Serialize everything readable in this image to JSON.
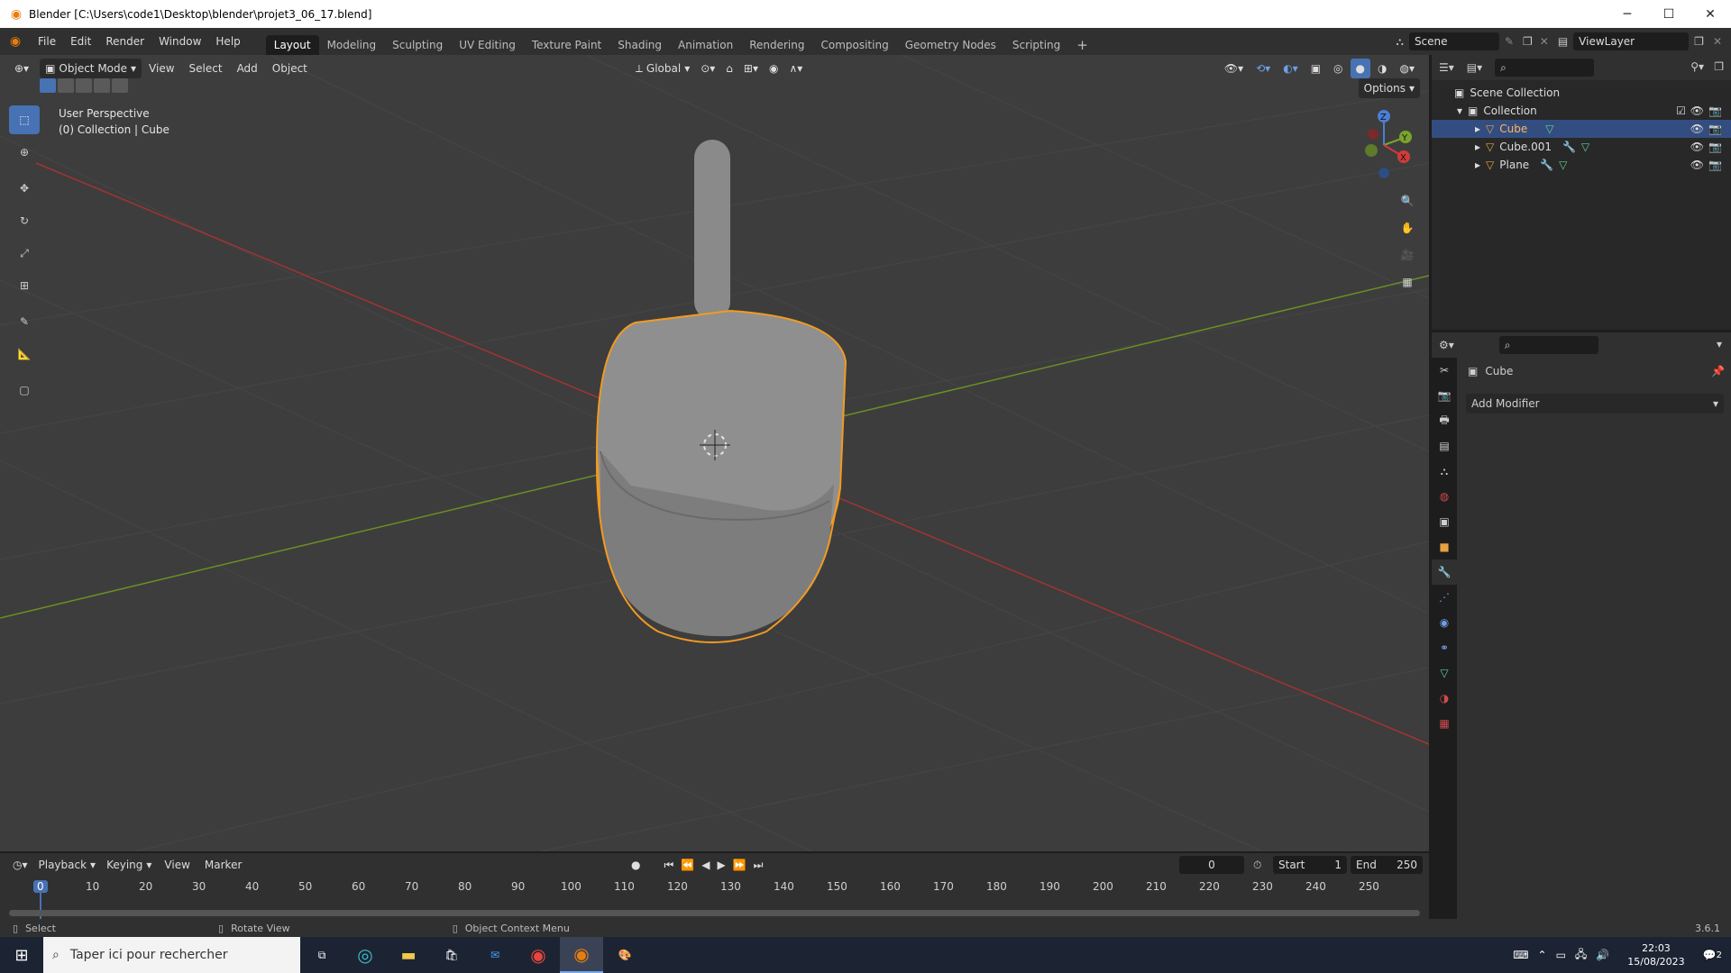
{
  "window": {
    "title": "Blender [C:\\Users\\code1\\Desktop\\blender\\projet3_06_17.blend]"
  },
  "menu": [
    "File",
    "Edit",
    "Render",
    "Window",
    "Help"
  ],
  "workspaces": [
    "Layout",
    "Modeling",
    "Sculpting",
    "UV Editing",
    "Texture Paint",
    "Shading",
    "Animation",
    "Rendering",
    "Compositing",
    "Geometry Nodes",
    "Scripting"
  ],
  "top_right": {
    "scene": "Scene",
    "view_layer": "ViewLayer"
  },
  "viewport": {
    "mode": "Object Mode",
    "menus": [
      "View",
      "Select",
      "Add",
      "Object"
    ],
    "transform_orientation": "Global",
    "options_label": "Options",
    "overlay_line1": "User Perspective",
    "overlay_line2": "(0) Collection | Cube",
    "gizmo": {
      "z": "Z",
      "y": "Y",
      "x": "X"
    }
  },
  "outliner": {
    "root": "Scene Collection",
    "collection": "Collection",
    "items": [
      {
        "name": "Cube",
        "selected": true
      },
      {
        "name": "Cube.001",
        "selected": false
      },
      {
        "name": "Plane",
        "selected": false
      }
    ]
  },
  "properties": {
    "object_name": "Cube",
    "add_modifier": "Add Modifier"
  },
  "timeline": {
    "menus": [
      "Playback",
      "Keying",
      "View",
      "Marker"
    ],
    "current_frame": "0",
    "start_label": "Start",
    "start_value": "1",
    "end_label": "End",
    "end_value": "250",
    "ticks": [
      "0",
      "10",
      "20",
      "30",
      "40",
      "50",
      "60",
      "70",
      "80",
      "90",
      "100",
      "110",
      "120",
      "130",
      "140",
      "150",
      "160",
      "170",
      "180",
      "190",
      "200",
      "210",
      "220",
      "230",
      "240",
      "250"
    ]
  },
  "statusbar": {
    "select": "Select",
    "rotate": "Rotate View",
    "context": "Object Context Menu",
    "version": "3.6.1"
  },
  "taskbar": {
    "search_placeholder": "Taper ici pour rechercher",
    "time": "22:03",
    "date": "15/08/2023",
    "notifications": "2"
  },
  "colors": {
    "selection_outline": "#f29a22",
    "active_tab": "#4772b3",
    "x_axis": "#d23a3a",
    "y_axis": "#7aa32c"
  }
}
